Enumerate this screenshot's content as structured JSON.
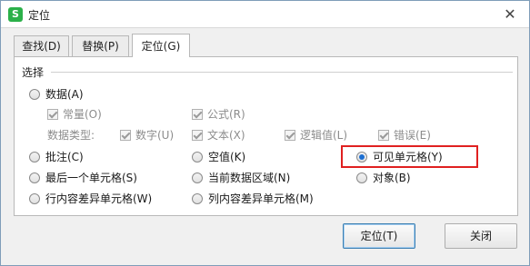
{
  "window": {
    "title": "定位",
    "app_icon_glyph": "S",
    "close_glyph": "✕"
  },
  "tabs": [
    {
      "label": "查找(D)",
      "active": false
    },
    {
      "label": "替换(P)",
      "active": false
    },
    {
      "label": "定位(G)",
      "active": true
    }
  ],
  "group": {
    "label": "选择"
  },
  "options": {
    "data": "数据(A)",
    "data_sub": {
      "constant": "常量(O)",
      "formula": "公式(R)",
      "type_label": "数据类型:",
      "number": "数字(U)",
      "text": "文本(X)",
      "logical": "逻辑值(L)",
      "error": "错误(E)"
    },
    "comments": "批注(C)",
    "blanks": "空值(K)",
    "visible_cells": "可见单元格(Y)",
    "last_cell": "最后一个单元格(S)",
    "current_region": "当前数据区域(N)",
    "objects": "对象(B)",
    "row_diff": "行内容差异单元格(W)",
    "col_diff": "列内容差异单元格(M)"
  },
  "selected_option": "visible_cells",
  "buttons": {
    "goto": "定位(T)",
    "close": "关闭"
  },
  "colors": {
    "highlight": "#e02020",
    "radio_selected": "#1d6fd1",
    "app_icon": "#2bb049"
  }
}
